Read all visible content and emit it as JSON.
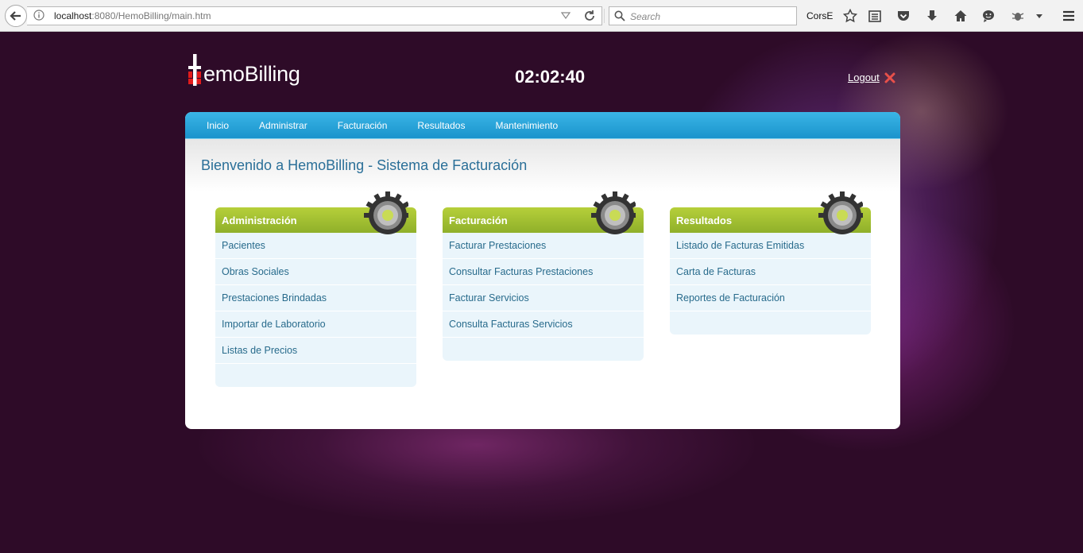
{
  "browser": {
    "url_host": "localhost",
    "url_rest": ":8080/HemoBilling/main.htm",
    "search_placeholder": "Search",
    "extension_label": "CorsE"
  },
  "header": {
    "logo_text": "emoBilling",
    "clock": "02:02:40",
    "logout_label": "Logout"
  },
  "nav": {
    "items": [
      "Inicio",
      "Administrar",
      "Facturación",
      "Resultados",
      "Mantenimiento"
    ]
  },
  "welcome": "Bienvenido a HemoBilling - Sistema de Facturación",
  "sections": [
    {
      "title": "Administración",
      "links": [
        "Pacientes",
        "Obras Sociales",
        "Prestaciones Brindadas",
        "Importar de Laboratorio",
        "Listas de Precios"
      ]
    },
    {
      "title": "Facturación",
      "links": [
        "Facturar Prestaciones",
        "Consultar Facturas Prestaciones",
        "Facturar Servicios",
        "Consulta Facturas Servicios"
      ]
    },
    {
      "title": "Resultados",
      "links": [
        "Listado de Facturas Emitidas",
        "Carta de Facturas",
        "Reportes de Facturación"
      ]
    }
  ],
  "colors": {
    "background": "#2e0b28",
    "nav_blue": "#1a93cc",
    "section_green": "#9cbc2f",
    "link_blue": "#286b8c"
  }
}
